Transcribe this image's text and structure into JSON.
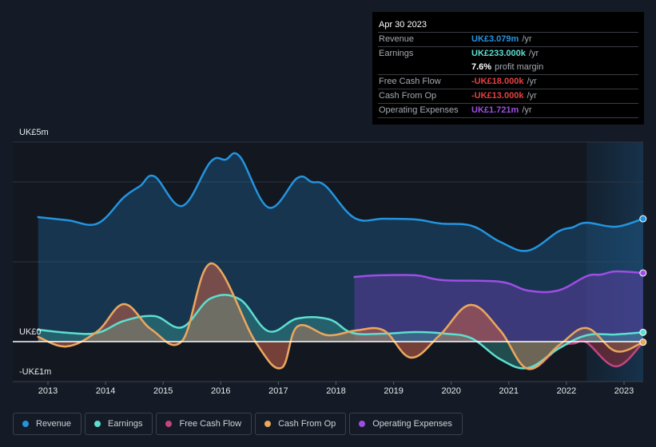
{
  "tooltip": {
    "date": "Apr 30 2023",
    "rows": [
      {
        "label": "Revenue",
        "value": "UK£3.079m",
        "unit": "/yr",
        "color": "#2394df"
      },
      {
        "label": "Earnings",
        "value": "UK£233.000k",
        "unit": "/yr",
        "color": "#5ddfd0"
      },
      {
        "label": "",
        "value": "7.6%",
        "unit": "profit margin",
        "color": "#ffffff"
      },
      {
        "label": "Free Cash Flow",
        "value": "-UK£18.000k",
        "unit": "/yr",
        "color": "#e64141"
      },
      {
        "label": "Cash From Op",
        "value": "-UK£13.000k",
        "unit": "/yr",
        "color": "#e64141"
      },
      {
        "label": "Operating Expenses",
        "value": "UK£1.721m",
        "unit": "/yr",
        "color": "#9f4de6"
      }
    ]
  },
  "legend": [
    {
      "label": "Revenue",
      "color": "#2394df"
    },
    {
      "label": "Earnings",
      "color": "#5ddfd0"
    },
    {
      "label": "Free Cash Flow",
      "color": "#c4447f"
    },
    {
      "label": "Cash From Op",
      "color": "#e8a95b"
    },
    {
      "label": "Operating Expenses",
      "color": "#9f4de6"
    }
  ],
  "chart_data": {
    "type": "area",
    "title": "",
    "xlabel": "",
    "ylabel": "",
    "y_tick_labels": [
      "UK£5m",
      "UK£0",
      "-UK£1m"
    ],
    "ylim": [
      -1,
      5
    ],
    "y_gridlines": [
      5,
      4,
      2,
      0,
      -1
    ],
    "x_tick_labels": [
      "2013",
      "2014",
      "2015",
      "2016",
      "2017",
      "2018",
      "2019",
      "2020",
      "2021",
      "2022",
      "2023"
    ],
    "x_ticks": [
      2013,
      2014,
      2015,
      2016,
      2017,
      2018,
      2019,
      2020,
      2021,
      2022,
      2023
    ],
    "xlim": [
      2012.6,
      2023.35
    ],
    "highlight_range": [
      2022.35,
      2023.33
    ],
    "units": "UK£ millions",
    "series": [
      {
        "name": "Revenue",
        "color": "#2394df",
        "x": [
          2012.83,
          2013.35,
          2013.86,
          2014.32,
          2014.6,
          2014.85,
          2015.33,
          2015.82,
          2016.08,
          2016.33,
          2016.83,
          2017.33,
          2017.58,
          2017.82,
          2018.32,
          2018.83,
          2019.39,
          2019.81,
          2020.36,
          2020.85,
          2021.33,
          2021.86,
          2022.1,
          2022.35,
          2022.86,
          2023.33
        ],
        "y": [
          3.12,
          3.04,
          2.96,
          3.62,
          3.9,
          4.14,
          3.4,
          4.5,
          4.56,
          4.64,
          3.36,
          4.1,
          4.0,
          3.9,
          3.1,
          3.08,
          3.06,
          2.96,
          2.9,
          2.5,
          2.28,
          2.76,
          2.86,
          2.98,
          2.88,
          3.079
        ]
      },
      {
        "name": "Earnings",
        "color": "#5ddfd0",
        "x": [
          2012.83,
          2013.35,
          2013.86,
          2014.32,
          2014.85,
          2015.33,
          2015.82,
          2016.33,
          2016.83,
          2017.33,
          2017.88,
          2018.28,
          2018.83,
          2019.39,
          2019.9,
          2020.36,
          2020.85,
          2021.33,
          2021.88,
          2022.35,
          2022.86,
          2023.33
        ],
        "y": [
          0.3,
          0.22,
          0.22,
          0.52,
          0.64,
          0.36,
          1.08,
          1.06,
          0.26,
          0.58,
          0.56,
          0.22,
          0.2,
          0.24,
          0.2,
          0.08,
          -0.44,
          -0.66,
          -0.16,
          0.16,
          0.18,
          0.233
        ]
      },
      {
        "name": "Free Cash Flow",
        "color": "#c4447f",
        "x": [
          2012.83,
          2013.32,
          2013.86,
          2014.32,
          2014.8,
          2015.33,
          2015.84,
          2016.6,
          2017.05,
          2017.33,
          2017.86,
          2018.35,
          2018.83,
          2019.3,
          2019.8,
          2020.33,
          2020.85,
          2021.33,
          2021.88,
          2022.15,
          2022.35,
          2022.86,
          2023.33
        ],
        "y": [
          0.12,
          -0.12,
          0.26,
          0.94,
          0.3,
          0.02,
          1.96,
          0.0,
          -0.66,
          0.38,
          0.16,
          0.28,
          0.28,
          -0.4,
          0.16,
          0.92,
          0.28,
          -0.68,
          -0.14,
          -0.04,
          -0.02,
          -0.62,
          -0.018
        ]
      },
      {
        "name": "Cash From Op",
        "color": "#e8a95b",
        "x": [
          2012.83,
          2013.32,
          2013.86,
          2014.32,
          2014.8,
          2015.33,
          2015.84,
          2016.6,
          2017.05,
          2017.33,
          2017.86,
          2018.35,
          2018.83,
          2019.3,
          2019.8,
          2020.33,
          2020.85,
          2021.33,
          2021.88,
          2022.35,
          2022.86,
          2023.33
        ],
        "y": [
          0.12,
          -0.12,
          0.26,
          0.94,
          0.3,
          0.02,
          1.96,
          0.0,
          -0.66,
          0.38,
          0.16,
          0.28,
          0.28,
          -0.4,
          0.16,
          0.92,
          0.28,
          -0.68,
          -0.08,
          0.34,
          -0.24,
          -0.013
        ]
      },
      {
        "name": "Operating Expenses",
        "color": "#9f4de6",
        "x": [
          2018.32,
          2018.7,
          2019.39,
          2019.86,
          2020.85,
          2021.33,
          2021.85,
          2022.35,
          2022.6,
          2022.86,
          2023.33
        ],
        "y": [
          1.62,
          1.66,
          1.66,
          1.54,
          1.5,
          1.28,
          1.28,
          1.64,
          1.68,
          1.76,
          1.721
        ]
      }
    ]
  }
}
